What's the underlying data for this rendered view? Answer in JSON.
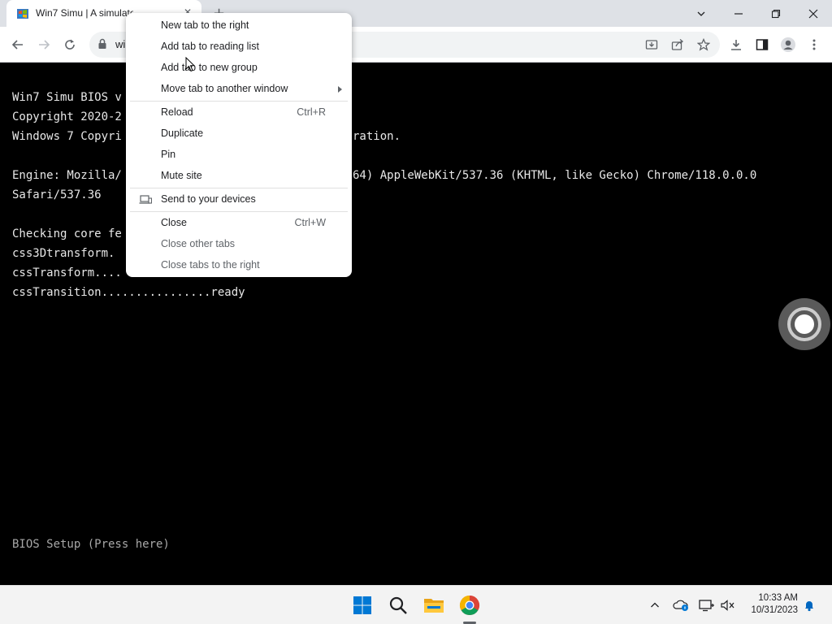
{
  "browser": {
    "tab_title": "Win7 Simu | A simulator of Windows 7",
    "tab_close": "✕",
    "new_tab": "+",
    "url": "wi"
  },
  "context_menu": {
    "items": [
      {
        "label": "New tab to the right",
        "shortcut": ""
      },
      {
        "label": "Add tab to reading list",
        "shortcut": ""
      },
      {
        "label": "Add tab to new group",
        "shortcut": ""
      },
      {
        "label": "Move tab to another window",
        "shortcut": ""
      },
      {
        "label": "Reload",
        "shortcut": "Ctrl+R"
      },
      {
        "label": "Duplicate",
        "shortcut": ""
      },
      {
        "label": "Pin",
        "shortcut": ""
      },
      {
        "label": "Mute site",
        "shortcut": ""
      },
      {
        "label": "Send to your devices",
        "shortcut": ""
      },
      {
        "label": "Close",
        "shortcut": "Ctrl+W"
      },
      {
        "label": "Close other tabs",
        "shortcut": ""
      },
      {
        "label": "Close tabs to the right",
        "shortcut": ""
      }
    ]
  },
  "terminal": {
    "lines": [
      "Win7 Simu BIOS v",
      "Copyright 2020-2",
      "Windows 7 Copyri",
      "Engine: Mozilla/",
      "Safari/537.36",
      "Checking core fe",
      "css3Dtransform.",
      "cssTransform....",
      "cssTransition................ready"
    ],
    "right_fragments": [
      "ration.",
      "64) AppleWebKit/537.36 (KHTML, like Gecko) Chrome/118.0.0.0"
    ],
    "bios_setup": "BIOS Setup (Press here)"
  },
  "taskbar": {
    "time": "10:33 AM",
    "date": "10/31/2023"
  },
  "colors": {
    "terminal_bg": "#000000",
    "terminal_fg": "#e8e8e8",
    "start_blue": "#0078d4"
  }
}
